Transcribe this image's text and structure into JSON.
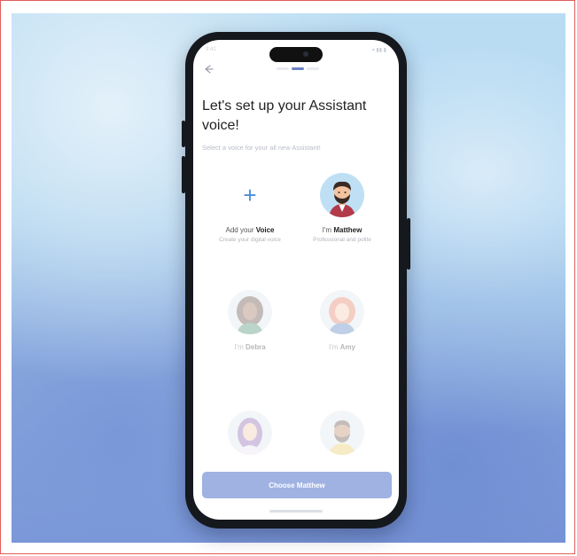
{
  "screen": {
    "title": "Let's set up your Assistant voice!",
    "subtitle": "Select a voice for your all new Assistant!",
    "progress": {
      "current_step": 2,
      "total_steps": 3
    }
  },
  "status_bar": {
    "time": "9:41",
    "right": "▾ ▮▮ ▮"
  },
  "voices": [
    {
      "type": "add",
      "prefix": "Add your",
      "name": "Voice",
      "desc": "Create your digital voice",
      "icon": "plus-icon",
      "faded": false
    },
    {
      "type": "voice",
      "prefix": "I'm",
      "name": "Matthew",
      "desc": "Professional and polite",
      "icon": "man-avatar",
      "faded": false,
      "selected": true
    },
    {
      "type": "voice",
      "prefix": "I'm",
      "name": "Debra",
      "desc": "",
      "icon": "woman-avatar-dark",
      "faded": true
    },
    {
      "type": "voice",
      "prefix": "I'm",
      "name": "Amy",
      "desc": "",
      "icon": "woman-avatar-redhead",
      "faded": true
    },
    {
      "type": "voice",
      "prefix": "",
      "name": "",
      "desc": "",
      "icon": "woman-avatar-purple",
      "faded": true
    },
    {
      "type": "voice",
      "prefix": "",
      "name": "",
      "desc": "",
      "icon": "man-avatar-beard",
      "faded": true
    }
  ],
  "choose_button": {
    "label": "Choose Matthew"
  },
  "colors": {
    "accent": "#4a8ed8",
    "button": "#9fb2e2",
    "progress_active": "#6b82c6",
    "phone_frame": "#15181d"
  }
}
